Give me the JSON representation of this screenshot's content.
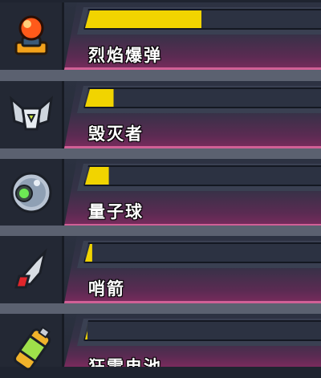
{
  "items": [
    {
      "name": "烈焰爆弹",
      "progress": 0.49,
      "icon": "fire-bomb-icon"
    },
    {
      "name": "毁灭者",
      "progress": 0.12,
      "icon": "destroyer-drone-icon"
    },
    {
      "name": "量子球",
      "progress": 0.1,
      "icon": "quantum-orb-icon"
    },
    {
      "name": "哨箭",
      "progress": 0.03,
      "icon": "sentinel-arrow-icon"
    },
    {
      "name": "狂雷电池",
      "progress": 0.01,
      "icon": "thunder-battery-icon"
    }
  ],
  "colors": {
    "bar_fill": "#f1d400",
    "track": "#2c3242",
    "card_accent": "#7a2b5d"
  }
}
